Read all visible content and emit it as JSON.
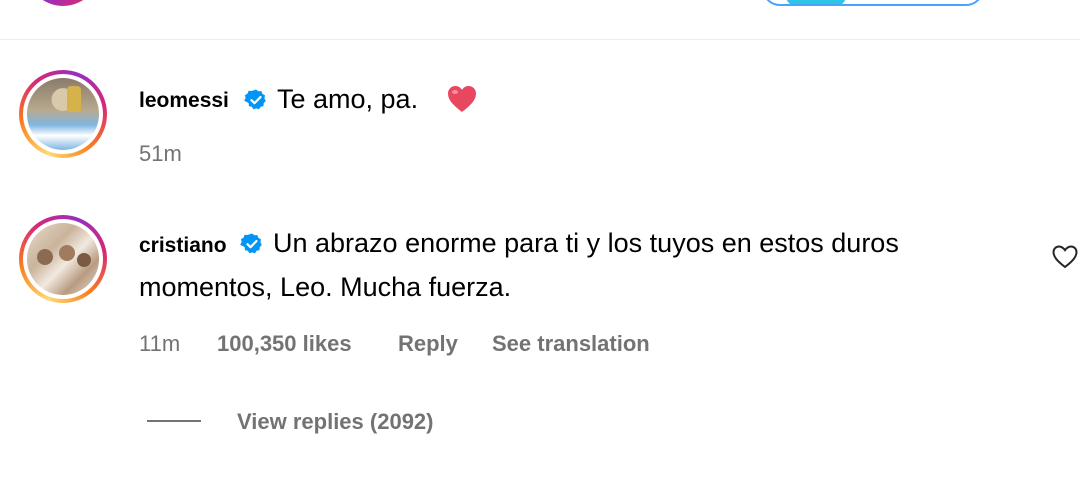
{
  "comments": [
    {
      "username": "leomessi",
      "text": "Te amo, pa.",
      "emoji": "red-heart",
      "time": "51m"
    },
    {
      "username": "cristiano",
      "text_line1": "Un abrazo enorme para ti y los tuyos en estos duros",
      "text_line2": "momentos, Leo. Mucha fuerza.",
      "time": "11m",
      "likes": "100,350 likes",
      "reply_label": "Reply",
      "translation_label": "See translation",
      "view_replies": "View replies (2092)"
    }
  ],
  "colors": {
    "verified": "#0095f6",
    "secondary_text": "#737373",
    "emoji_heart": "#e8485f"
  },
  "icons": [
    "verified-badge-icon",
    "heart-emoji-icon",
    "like-heart-icon"
  ]
}
